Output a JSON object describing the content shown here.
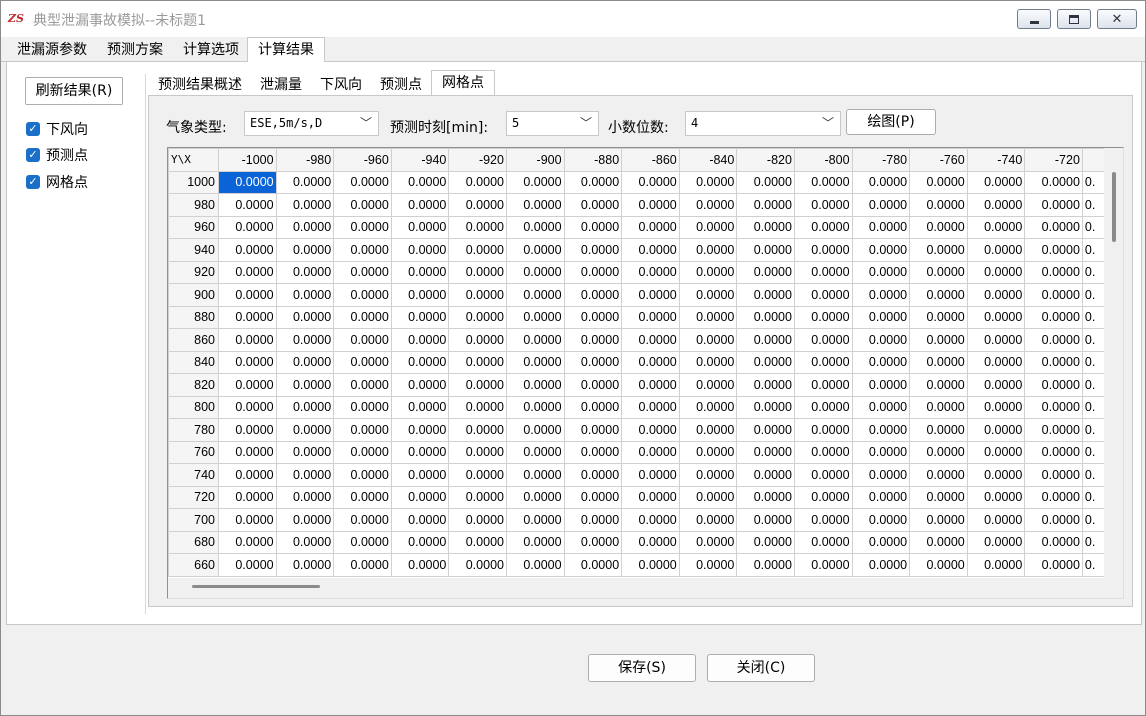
{
  "window": {
    "icon_text": "ZS",
    "title": "典型泄漏事故模拟--未标题1"
  },
  "main_tabs": [
    {
      "label": "泄漏源参数"
    },
    {
      "label": "预测方案"
    },
    {
      "label": "计算选项"
    },
    {
      "label": "计算结果"
    }
  ],
  "active_main_tab": "计算结果",
  "left_panel": {
    "refresh_label": "刷新结果(R)",
    "checks": [
      {
        "label": "下风向",
        "checked": true
      },
      {
        "label": "预测点",
        "checked": true
      },
      {
        "label": "网格点",
        "checked": true
      }
    ]
  },
  "sub_tabs": [
    {
      "label": "预测结果概述"
    },
    {
      "label": "泄漏量"
    },
    {
      "label": "下风向"
    },
    {
      "label": "预测点"
    },
    {
      "label": "网格点"
    }
  ],
  "active_sub_tab": "网格点",
  "toolbar": {
    "weather_label": "气象类型:",
    "weather_value": "ESE,5m/s,D",
    "time_label": "预测时刻[min]:",
    "time_value": "5",
    "decimals_label": "小数位数:",
    "decimals_value": "4",
    "draw_label": "绘图(P)"
  },
  "grid": {
    "corner": "Y\\X",
    "columns": [
      "-1000",
      "-980",
      "-960",
      "-940",
      "-920",
      "-900",
      "-880",
      "-860",
      "-840",
      "-820",
      "-800",
      "-780",
      "-760",
      "-740",
      "-720",
      ""
    ],
    "rows": [
      "1000",
      "980",
      "960",
      "940",
      "920",
      "900",
      "880",
      "860",
      "840",
      "820",
      "800",
      "780",
      "760",
      "740",
      "720",
      "700",
      "680",
      "660"
    ],
    "cell_value": "0.0000",
    "partial_cell": "0.",
    "selected": {
      "row": 0,
      "col": 0
    }
  },
  "footer": {
    "save_label": "保存(S)",
    "close_label": "关闭(C)"
  }
}
